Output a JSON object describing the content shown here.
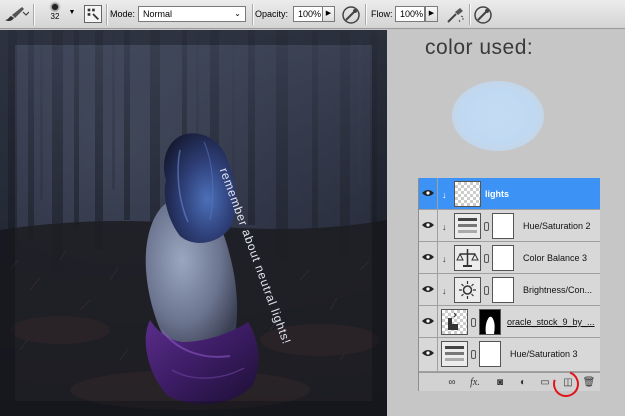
{
  "options_bar": {
    "brush_size": "32",
    "mode_label": "Mode:",
    "mode_value": "Normal",
    "opacity_label": "Opacity:",
    "opacity_value": "100%",
    "flow_label": "Flow:",
    "flow_value": "100%"
  },
  "canvas": {
    "note_text": "remember about neutral lights!"
  },
  "side": {
    "color_title": "color used:",
    "swatch_color": "#c2daf2"
  },
  "layers": {
    "rows": [
      {
        "name": "lights",
        "selected": true
      },
      {
        "name": "Hue/Saturation 2",
        "selected": false
      },
      {
        "name": "Color Balance 3",
        "selected": false
      },
      {
        "name": "Brightness/Con...",
        "selected": false
      },
      {
        "name": "oracle_stock_9_by_...",
        "selected": false
      },
      {
        "name": "Hue/Saturation 3",
        "selected": false
      }
    ],
    "footer_icons": [
      "link-icon",
      "fx-icon",
      "mask-icon",
      "adjustment-icon",
      "folder-icon",
      "new-layer-icon",
      "trash-icon"
    ]
  },
  "colors": {
    "selection_blue": "#3d93f5",
    "highlight_red": "#e0151a"
  }
}
